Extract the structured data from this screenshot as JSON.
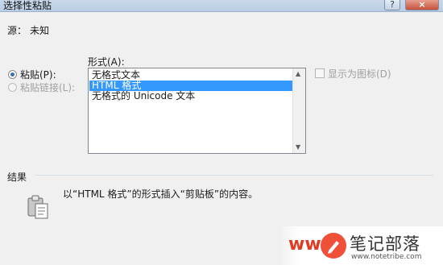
{
  "window": {
    "title": "选择性粘贴",
    "help_button": "?",
    "close_button": "×"
  },
  "source": {
    "label": "源：",
    "value": "未知"
  },
  "paste_options": {
    "paste_label": "粘贴(P):",
    "paste_selected": true,
    "paste_link_label": "粘贴链接(L):",
    "paste_link_enabled": false
  },
  "format": {
    "label": "形式(A):",
    "items": [
      "无格式文本",
      "HTML 格式",
      "无格式的 Unicode 文本"
    ],
    "selected_index": 1
  },
  "display_as_icon": {
    "label": "显示为图标(D)",
    "checked": false,
    "enabled": false
  },
  "result": {
    "label": "结果",
    "description": "以“HTML 格式”的形式插入“剪贴板”的内容。"
  },
  "watermark": {
    "www": "www",
    "name": "笔记部落",
    "url": "www.notetribe.com"
  },
  "colors": {
    "selection": "#3399ff",
    "title_bar": "#c9d8ea",
    "watermark_accent": "#f0503a"
  }
}
